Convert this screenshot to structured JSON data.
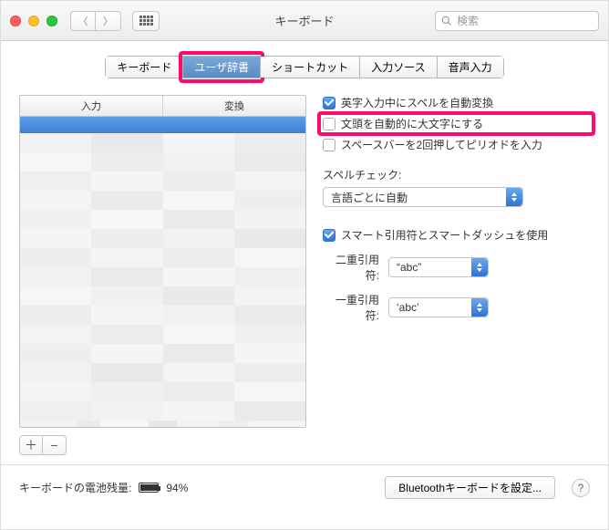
{
  "window": {
    "title": "キーボード"
  },
  "search": {
    "placeholder": "検索"
  },
  "tabs": [
    {
      "label": "キーボード",
      "active": false
    },
    {
      "label": "ユーザ辞書",
      "active": true,
      "highlight": true
    },
    {
      "label": "ショートカット",
      "active": false
    },
    {
      "label": "入力ソース",
      "active": false
    },
    {
      "label": "音声入力",
      "active": false
    }
  ],
  "table": {
    "headers": [
      "入力",
      "変換"
    ]
  },
  "buttons": {
    "add": "＋",
    "remove": "−"
  },
  "options": {
    "spellcheck_eng": {
      "label": "英字入力中にスペルを自動変換",
      "checked": true
    },
    "auto_capitalize": {
      "label": "文頭を自動的に大文字にする",
      "checked": false,
      "highlight": true
    },
    "space_period": {
      "label": "スペースバーを2回押してピリオドを入力",
      "checked": false
    }
  },
  "spellcheck": {
    "label": "スペルチェック:",
    "value": "言語ごとに自動"
  },
  "smartquotes": {
    "enable": {
      "label": "スマート引用符とスマートダッシュを使用",
      "checked": true
    },
    "double": {
      "label": "二重引用符:",
      "value": "“abc”"
    },
    "single": {
      "label": "一重引用符:",
      "value": "‘abc’"
    }
  },
  "footer": {
    "battery_label": "キーボードの電池残量:",
    "battery_pct": "94%",
    "bluetooth_btn": "Bluetoothキーボードを設定...",
    "help": "?"
  }
}
